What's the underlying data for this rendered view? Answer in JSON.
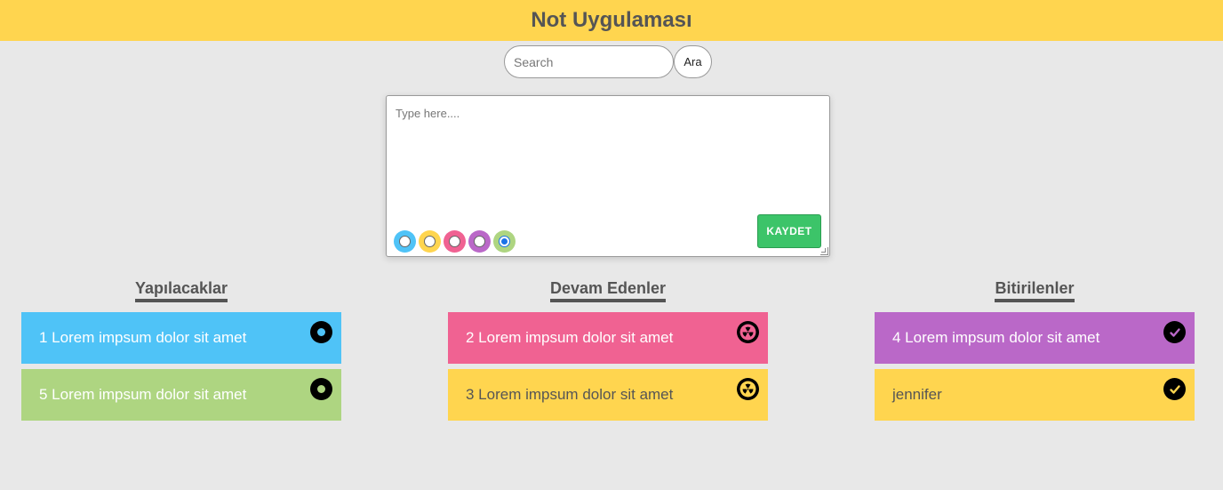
{
  "app": {
    "title": "Not Uygulaması"
  },
  "search": {
    "placeholder": "Search",
    "button_label": "Ara"
  },
  "editor": {
    "placeholder": "Type here....",
    "save_label": "KAYDET",
    "colors": [
      "#4fc3f7",
      "#ffd54f",
      "#f06292",
      "#ba68c8",
      "#aed581"
    ],
    "selected_color_index": 4
  },
  "columns": [
    {
      "title": "Yapılacaklar",
      "status_icon": "record-icon",
      "notes": [
        {
          "text": "1 Lorem impsum dolor sit amet",
          "color": "#4fc3f7",
          "text_color": "#ffffff"
        },
        {
          "text": "5 Lorem impsum dolor sit amet",
          "color": "#aed581",
          "text_color": "#ffffff"
        }
      ]
    },
    {
      "title": "Devam Edenler",
      "status_icon": "radiation-icon",
      "notes": [
        {
          "text": "2 Lorem impsum dolor sit amet",
          "color": "#f06292",
          "text_color": "#ffffff"
        },
        {
          "text": "3 Lorem impsum dolor sit amet",
          "color": "#ffd54f",
          "text_color": "#555555"
        }
      ]
    },
    {
      "title": "Bitirilenler",
      "status_icon": "check-icon",
      "notes": [
        {
          "text": "4 Lorem impsum dolor sit amet",
          "color": "#ba68c8",
          "text_color": "#ffffff"
        },
        {
          "text": "jennifer",
          "color": "#ffd54f",
          "text_color": "#555555"
        }
      ]
    }
  ]
}
